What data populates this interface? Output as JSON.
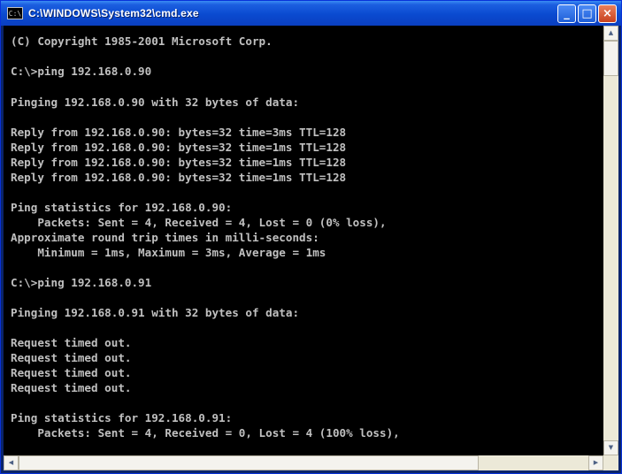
{
  "window": {
    "title": "C:\\WINDOWS\\System32\\cmd.exe",
    "icon": "console-icon",
    "icon_glyph": "C:\\",
    "buttons": {
      "minimize": "_",
      "maximize": "□",
      "close": "×"
    }
  },
  "console": {
    "lines": [
      "(C) Copyright 1985-2001 Microsoft Corp.",
      "C:\\>ping 192.168.0.90",
      "Pinging 192.168.0.90 with 32 bytes of data:",
      "Reply from 192.168.0.90: bytes=32 time=3ms TTL=128",
      "Reply from 192.168.0.90: bytes=32 time=1ms TTL=128",
      "Reply from 192.168.0.90: bytes=32 time=1ms TTL=128",
      "Reply from 192.168.0.90: bytes=32 time=1ms TTL=128",
      "Ping statistics for 192.168.0.90:",
      "    Packets: Sent = 4, Received = 4, Lost = 0 (0% loss),",
      "Approximate round trip times in milli-seconds:",
      "    Minimum = 1ms, Maximum = 3ms, Average = 1ms",
      "C:\\>ping 192.168.0.91",
      "Pinging 192.168.0.91 with 32 bytes of data:",
      "Request timed out.",
      "Request timed out.",
      "Request timed out.",
      "Request timed out.",
      "Ping statistics for 192.168.0.91:",
      "    Packets: Sent = 4, Received = 0, Lost = 4 (100% loss),"
    ]
  },
  "scrollbars": {
    "up_arrow": "▲",
    "down_arrow": "▼",
    "left_arrow": "◀",
    "right_arrow": "▶"
  }
}
